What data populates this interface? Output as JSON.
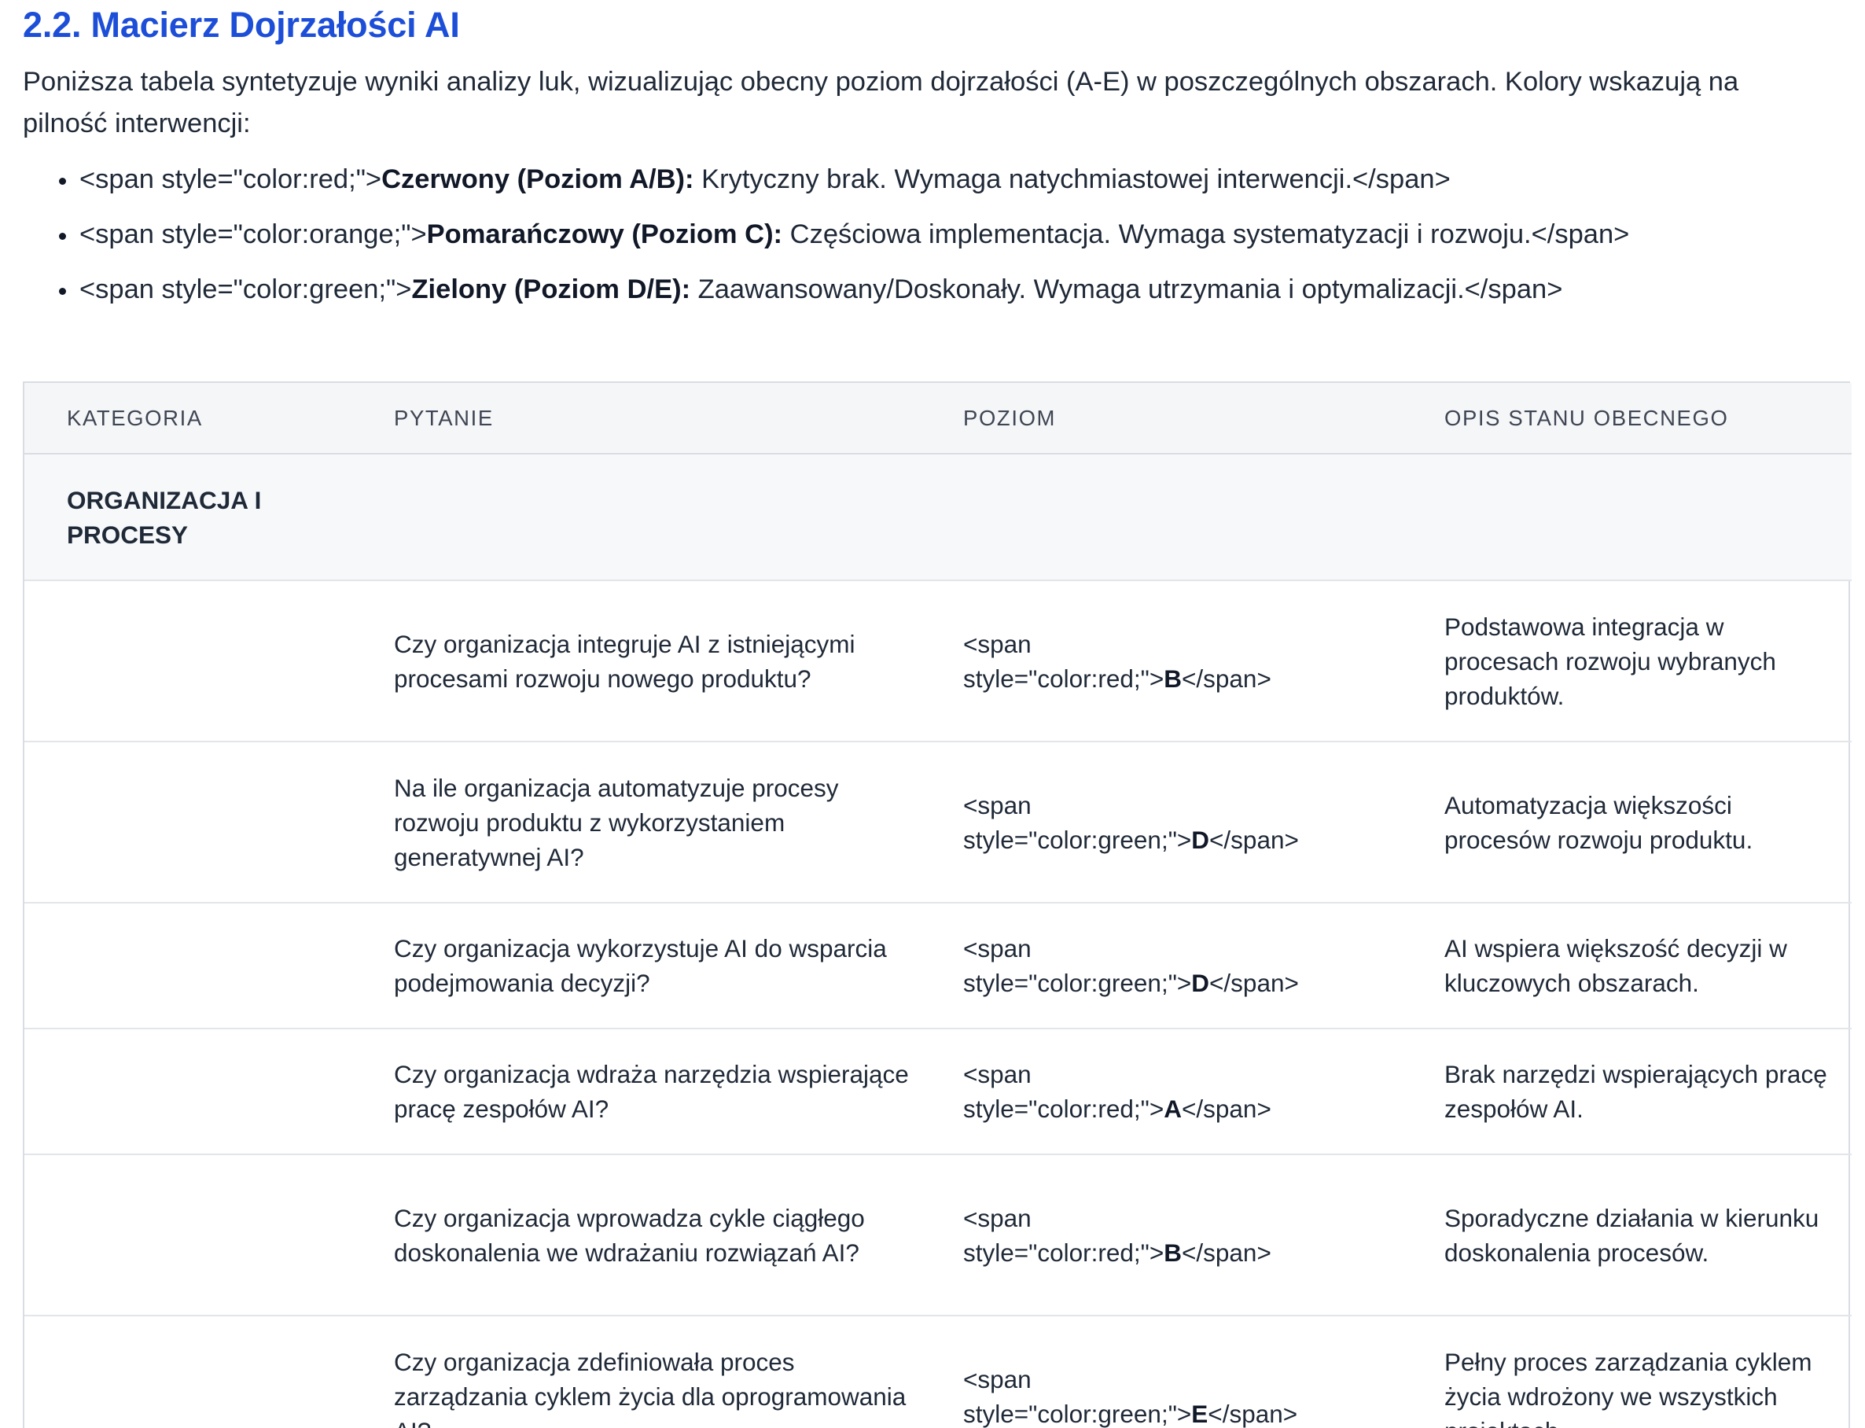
{
  "section": {
    "title": "2.2. Macierz Dojrzałości AI",
    "intro": "Poniższa tabela syntetyzuje wyniki analizy luk, wizualizując obecny poziom dojrzałości (A-E) w poszczególnych obszarach. Kolory wskazują na pilność interwencji:"
  },
  "legend": [
    {
      "prefix": "<span style=\"color:red;\">",
      "bold": "Czerwony (Poziom A/B):",
      "text": " Krytyczny brak. Wymaga natychmiastowej interwencji.</span>"
    },
    {
      "prefix": "<span style=\"color:orange;\">",
      "bold": "Pomarańczowy (Poziom C):",
      "text": " Częściowa implementacja. Wymaga systematyzacji i rozwoju.</span>"
    },
    {
      "prefix": "<span style=\"color:green;\">",
      "bold": "Zielony (Poziom D/E):",
      "text": " Zaawansowany/Doskonały. Wymaga utrzymania i optymalizacji.</span>"
    }
  ],
  "table": {
    "headers": [
      "KATEGORIA",
      "PYTANIE",
      "POZIOM",
      "OPIS STANU OBECNEGO"
    ],
    "category": "ORGANIZACJA I PROCESY",
    "rows": [
      {
        "question": "Czy organizacja integruje AI z istniejącymi procesami rozwoju nowego produktu?",
        "level_open_a": "<span",
        "level_open_b": "style=\"color:red;\">",
        "level": "B",
        "level_close": "</span>",
        "description": "Podstawowa integracja w procesach rozwoju wybranych produktów."
      },
      {
        "question": "Na ile organizacja automatyzuje procesy rozwoju produktu z wykorzystaniem generatywnej AI?",
        "level_open_a": "<span",
        "level_open_b": "style=\"color:green;\">",
        "level": "D",
        "level_close": "</span>",
        "description": "Automatyzacja większości procesów rozwoju produktu."
      },
      {
        "question": "Czy organizacja wykorzystuje AI do wsparcia podejmowania decyzji?",
        "level_open_a": "<span",
        "level_open_b": "style=\"color:green;\">",
        "level": "D",
        "level_close": "</span>",
        "description": "AI wspiera większość decyzji w kluczowych obszarach."
      },
      {
        "question": "Czy organizacja wdraża narzędzia wspierające pracę zespołów AI?",
        "level_open_a": "<span",
        "level_open_b": "style=\"color:red;\">",
        "level": "A",
        "level_close": "</span>",
        "description": "Brak narzędzi wspierających pracę zespołów AI."
      },
      {
        "question": "Czy organizacja wprowadza cykle ciągłego doskonalenia we wdrażaniu rozwiązań AI?",
        "level_open_a": "<span",
        "level_open_b": "style=\"color:red;\">",
        "level": "B",
        "level_close": "</span>",
        "description": "Sporadyczne działania w kierunku doskonalenia procesów."
      },
      {
        "question": "Czy organizacja zdefiniowała proces zarządzania cyklem życia dla oprogramowania AI?",
        "level_open_a": "<span",
        "level_open_b": "style=\"color:green;\">",
        "level": "E",
        "level_close": "</span>",
        "description": "Pełny proces zarządzania cyklem życia wdrożony we wszystkich projektach."
      }
    ]
  }
}
